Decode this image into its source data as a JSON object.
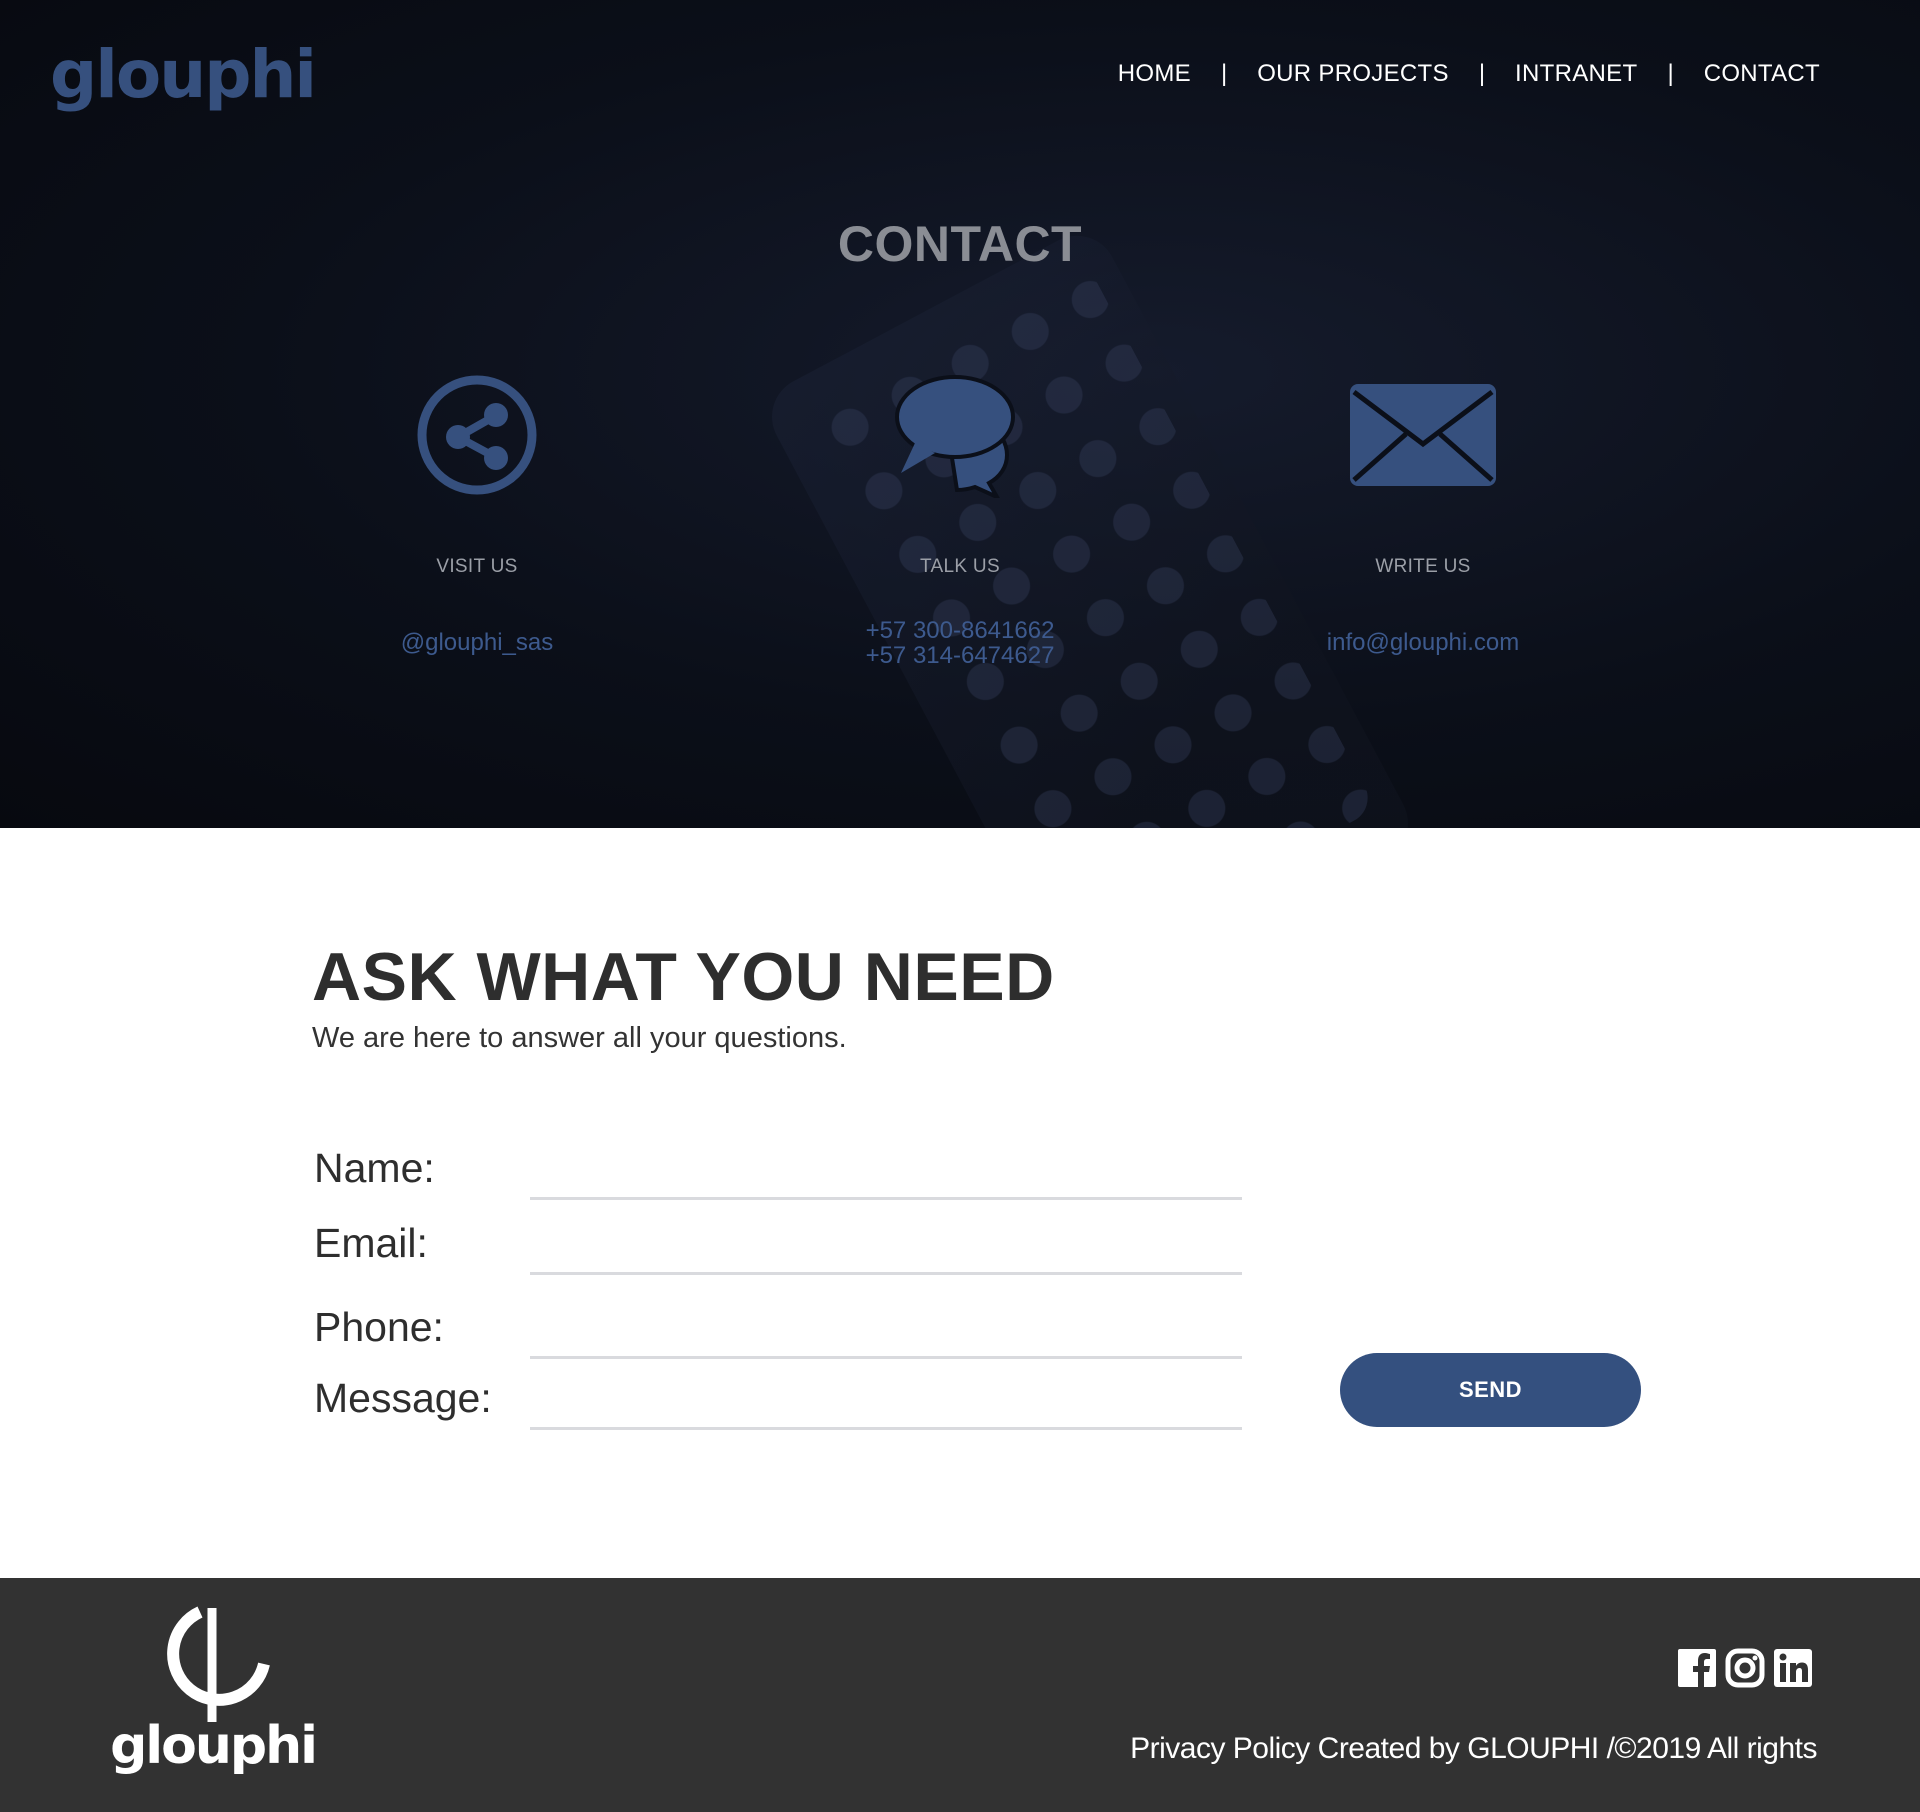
{
  "brand": {
    "name": "glouphi",
    "accent": "#36507e"
  },
  "nav": {
    "items": [
      {
        "label": "HOME"
      },
      {
        "label": "OUR PROJECTS"
      },
      {
        "label": "INTRANET"
      },
      {
        "label": "CONTACT"
      }
    ],
    "separator": "|"
  },
  "hero": {
    "title": "CONTACT",
    "columns": [
      {
        "icon": "share-icon",
        "label": "VISIT US",
        "lines": [
          "@glouphi_sas"
        ]
      },
      {
        "icon": "chat-bubbles-icon",
        "label": "TALK US",
        "lines": [
          "+57 300-8641662",
          "+57 314-6474627"
        ]
      },
      {
        "icon": "envelope-icon",
        "label": "WRITE US",
        "lines": [
          "info@glouphi.com"
        ]
      }
    ]
  },
  "form": {
    "heading": "ASK WHAT YOU NEED",
    "subheading": "We are here to answer all your questions.",
    "fields": [
      {
        "label": "Name:",
        "value": ""
      },
      {
        "label": "Email:",
        "value": ""
      },
      {
        "label": "Phone:",
        "value": ""
      },
      {
        "label": "Message:",
        "value": ""
      }
    ],
    "send_label": "SEND",
    "button_color": "#34507f"
  },
  "footer": {
    "logo_text": "glouphi",
    "social": [
      "facebook-icon",
      "instagram-icon",
      "linkedin-icon"
    ],
    "privacy_label": "Privacy Policy",
    "credit": " Created by GLOUPHI  /©2019 All rights"
  }
}
